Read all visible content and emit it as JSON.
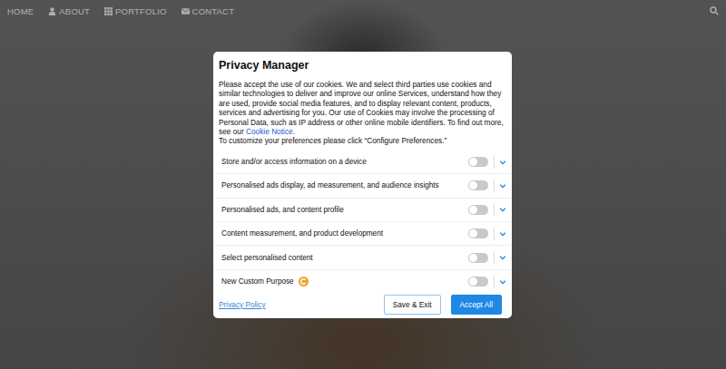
{
  "nav": {
    "items": [
      {
        "label": "HOME"
      },
      {
        "label": "ABOUT"
      },
      {
        "label": "PORTFOLIO"
      },
      {
        "label": "CONTACT"
      }
    ]
  },
  "dialog": {
    "title": "Privacy Manager",
    "description": "Please accept the use of our cookies. We and select third parties use cookies and similar technologies to deliver and improve our online Services, understand how they are used, provide social media features, and to display relevant content, products, services and advertising for you. Our use of Cookies may involve the processing of Personal Data, such as IP address or other online mobile identifiers. To find out more, see our",
    "link": "Cookie Notice.",
    "instruction": "To customize your preferences please click “Configure Preferences.”",
    "purposes": [
      {
        "label": "Store and/or access information on a device",
        "on": false,
        "expanded": false,
        "kind": "standard"
      },
      {
        "label": "Personalised ads display, ad measurement, and audience insights",
        "on": false,
        "expanded": false,
        "kind": "standard"
      },
      {
        "label": "Personalised ads, and content profile",
        "on": false,
        "expanded": false,
        "kind": "standard"
      },
      {
        "label": "Content measurement, and product development",
        "on": false,
        "expanded": false,
        "kind": "standard"
      },
      {
        "label": "Select personalised content",
        "on": false,
        "expanded": false,
        "kind": "standard"
      },
      {
        "label": "New Custom Purpose",
        "on": false,
        "expanded": false,
        "kind": "custom"
      }
    ],
    "privacy_policy": "Privacy Policy",
    "buttons": [
      {
        "label": "Save & Exit",
        "primary": false
      },
      {
        "label": "Accept All",
        "primary": true
      }
    ]
  }
}
